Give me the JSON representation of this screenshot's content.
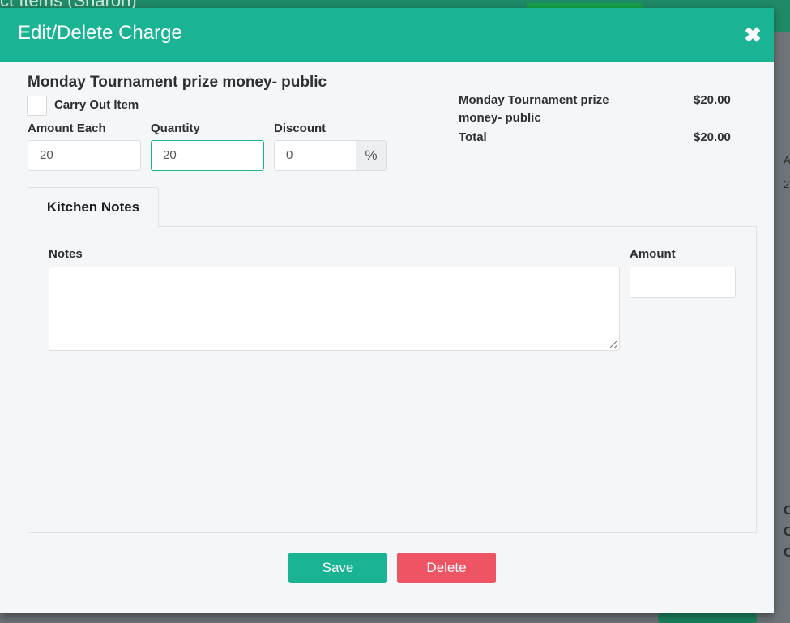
{
  "background": {
    "title_fragment": "ct Items (Sharon)",
    "right_fragments": [
      "A",
      "2",
      "C",
      "C",
      "C"
    ]
  },
  "modal": {
    "title": "Edit/Delete Charge",
    "close_icon": "close-icon"
  },
  "item": {
    "name": "Monday Tournament prize money- public",
    "carry_out_label": "Carry Out Item",
    "carry_out_checked": false
  },
  "fields": {
    "amount_each": {
      "label": "Amount Each",
      "value": "20"
    },
    "quantity": {
      "label": "Quantity",
      "value": "20"
    },
    "discount": {
      "label": "Discount",
      "value": "0",
      "addon": "%"
    }
  },
  "summary": {
    "item_line1": "Monday Tournament prize",
    "item_line2": "money- public",
    "item_amount": "$20.00",
    "total_label": "Total",
    "total_amount": "$20.00"
  },
  "tabs": [
    {
      "label": "Kitchen Notes",
      "active": true
    }
  ],
  "kitchen_notes": {
    "notes_label": "Notes",
    "notes_value": "",
    "amount_label": "Amount",
    "amount_value": ""
  },
  "buttons": {
    "save": "Save",
    "delete": "Delete"
  },
  "colors": {
    "accent": "#1ab394",
    "danger": "#ed5565"
  }
}
